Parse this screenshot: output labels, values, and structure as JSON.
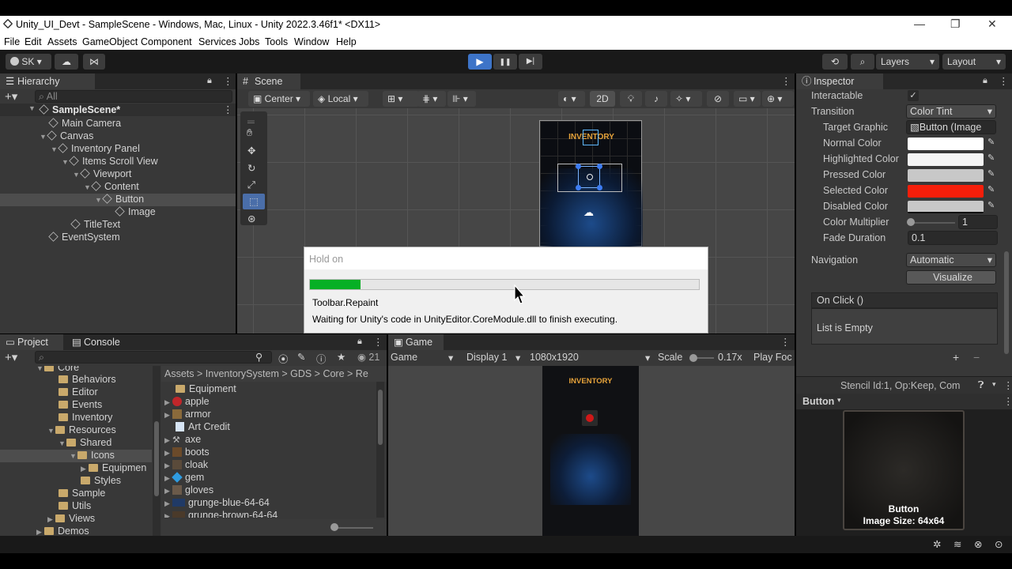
{
  "window": {
    "title": "Unity_UI_Devt - SampleScene - Windows, Mac, Linux - Unity 2022.3.46f1* <DX11>",
    "minimize": "—",
    "maximize": "❐",
    "close": "✕"
  },
  "menu": [
    "File",
    "Edit",
    "Assets",
    "GameObject",
    "Component",
    "Services",
    "Jobs",
    "Tools",
    "Window",
    "Help"
  ],
  "toolbar": {
    "account": "SK",
    "layers": "Layers",
    "layout": "Layout",
    "play": "▶",
    "pause": "❚❚",
    "step": "▶|"
  },
  "hierarchy": {
    "tab": "Hierarchy",
    "search_placeholder": "All",
    "scene": "SampleScene*",
    "items": [
      "Main Camera",
      "Canvas",
      "Inventory Panel",
      "Items Scroll View",
      "Viewport",
      "Content",
      "Button",
      "Image",
      "TitleText",
      "EventSystem"
    ]
  },
  "scene": {
    "tab": "Scene",
    "pivot": "Center",
    "space": "Local",
    "mode2d": "2D",
    "canvas_title": "INVENTORY"
  },
  "inspector": {
    "tab": "Inspector",
    "rows": [
      {
        "label": "Interactable",
        "value": "✓"
      },
      {
        "label": "Transition",
        "value": "Color Tint"
      },
      {
        "label": "Target Graphic",
        "value": "Button (Image"
      },
      {
        "label": "Normal Color",
        "value": ""
      },
      {
        "label": "Highlighted Color",
        "value": ""
      },
      {
        "label": "Pressed Color",
        "value": ""
      },
      {
        "label": "Selected Color",
        "value": ""
      },
      {
        "label": "Disabled Color",
        "value": ""
      },
      {
        "label": "Color Multiplier",
        "value": "1"
      },
      {
        "label": "Fade Duration",
        "value": "0.1"
      }
    ],
    "navigation_label": "Navigation",
    "navigation_value": "Automatic",
    "visualize": "Visualize",
    "onclick": "On Click ()",
    "list_empty": "List is Empty",
    "add": "+",
    "remove": "−",
    "stencil": "Stencil Id:1, Op:Keep, Com",
    "preview_title": "Button",
    "preview_name": "Button",
    "preview_size": "Image Size: 64x64",
    "colors": {
      "normal": "#ffffff",
      "highlighted": "#f5f5f5",
      "pressed": "#c8c8c8",
      "selected": "#f51e0a",
      "disabled": "#c8c8c8"
    }
  },
  "project": {
    "tab_project": "Project",
    "tab_console": "Console",
    "count": "21",
    "tree": [
      "Core",
      "Behaviors",
      "Editor",
      "Events",
      "Inventory",
      "Resources",
      "Shared",
      "Icons",
      "Equipmen",
      "Styles",
      "Sample",
      "Utils",
      "Views",
      "Demos"
    ],
    "breadcrumb": [
      "Assets",
      "InventorySystem",
      "GDS",
      "Core",
      "Re"
    ],
    "files": [
      "Equipment",
      "apple",
      "armor",
      "Art Credit",
      "axe",
      "boots",
      "cloak",
      "gem",
      "gloves",
      "grunge-blue-64-64",
      "grunge-brown-64-64"
    ]
  },
  "game": {
    "tab": "Game",
    "mode": "Game",
    "display": "Display 1",
    "resolution": "1080x1920",
    "scale_label": "Scale",
    "scale_value": "0.17x",
    "play_focus": "Play Foc",
    "canvas_title": "INVENTORY"
  },
  "dialog": {
    "title": "Hold on",
    "progress": 0.13,
    "line1": "Toolbar.Repaint",
    "line2": "Waiting for Unity's code in UnityEditor.CoreModule.dll to finish executing."
  }
}
